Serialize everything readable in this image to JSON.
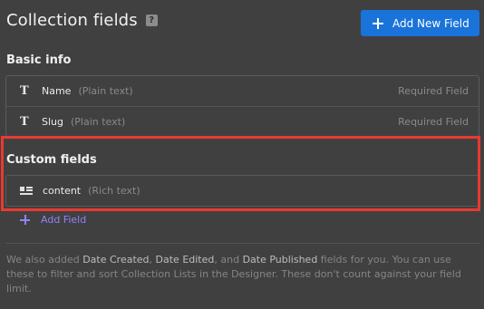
{
  "header": {
    "title": "Collection fields",
    "help_label": "?",
    "add_new_label": "Add New Field"
  },
  "basic_info": {
    "label": "Basic info",
    "fields": [
      {
        "name": "Name",
        "type": "(Plain text)",
        "status": "Required Field",
        "icon": "text-type-icon"
      },
      {
        "name": "Slug",
        "type": "(Plain text)",
        "status": "Required Field",
        "icon": "text-type-icon"
      }
    ]
  },
  "custom_fields": {
    "label": "Custom fields",
    "fields": [
      {
        "name": "content",
        "type": "(Rich text)",
        "icon": "rich-text-icon"
      }
    ],
    "add_label": "Add Field"
  },
  "note": {
    "t1": "We also added ",
    "b1": "Date Created",
    "t2": ", ",
    "b2": "Date Edited",
    "t3": ", and ",
    "b3": "Date Published",
    "t4": " fields for you. You can use these to filter and sort Collection Lists in the Designer. These don't count against your field limit."
  },
  "colors": {
    "accent": "#1a73d9",
    "highlight": "#e83a32",
    "link": "#8f83ff",
    "background": "#404040"
  }
}
